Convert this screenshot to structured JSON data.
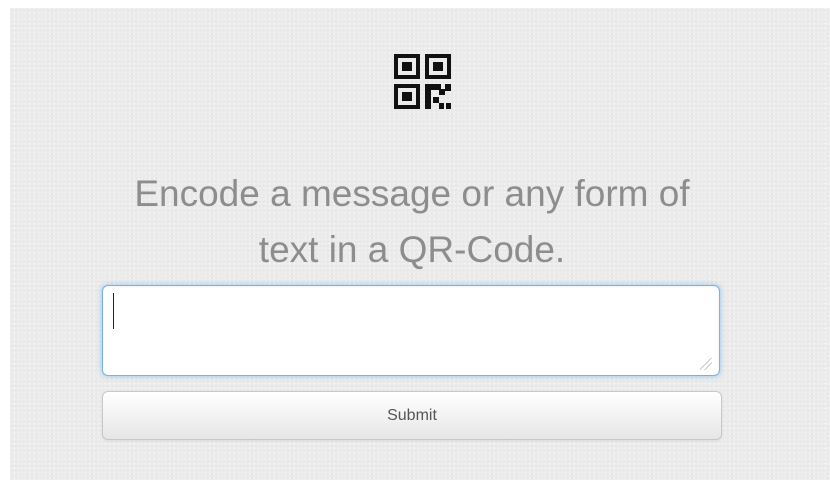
{
  "header": {
    "icon": "qr-code-icon"
  },
  "main": {
    "heading": "Encode a message or any form of text in a QR-Code.",
    "input": {
      "value": "",
      "placeholder": ""
    },
    "submit_label": "Submit"
  },
  "colors": {
    "heading_text": "#8d8d8d",
    "focus_border": "#7fb1e0",
    "panel_background": "#ececec"
  }
}
